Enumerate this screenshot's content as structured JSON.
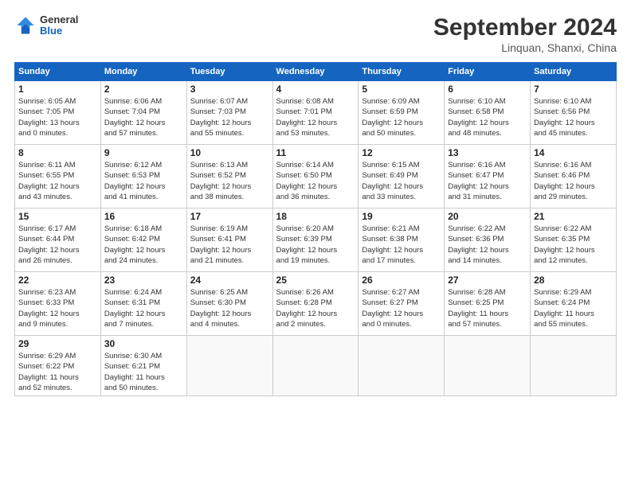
{
  "header": {
    "logo_general": "General",
    "logo_blue": "Blue",
    "month_title": "September 2024",
    "location": "Linquan, Shanxi, China"
  },
  "weekdays": [
    "Sunday",
    "Monday",
    "Tuesday",
    "Wednesday",
    "Thursday",
    "Friday",
    "Saturday"
  ],
  "weeks": [
    [
      {
        "day": "1",
        "info": "Sunrise: 6:05 AM\nSunset: 7:05 PM\nDaylight: 13 hours\nand 0 minutes."
      },
      {
        "day": "2",
        "info": "Sunrise: 6:06 AM\nSunset: 7:04 PM\nDaylight: 12 hours\nand 57 minutes."
      },
      {
        "day": "3",
        "info": "Sunrise: 6:07 AM\nSunset: 7:03 PM\nDaylight: 12 hours\nand 55 minutes."
      },
      {
        "day": "4",
        "info": "Sunrise: 6:08 AM\nSunset: 7:01 PM\nDaylight: 12 hours\nand 53 minutes."
      },
      {
        "day": "5",
        "info": "Sunrise: 6:09 AM\nSunset: 6:59 PM\nDaylight: 12 hours\nand 50 minutes."
      },
      {
        "day": "6",
        "info": "Sunrise: 6:10 AM\nSunset: 6:58 PM\nDaylight: 12 hours\nand 48 minutes."
      },
      {
        "day": "7",
        "info": "Sunrise: 6:10 AM\nSunset: 6:56 PM\nDaylight: 12 hours\nand 45 minutes."
      }
    ],
    [
      {
        "day": "8",
        "info": "Sunrise: 6:11 AM\nSunset: 6:55 PM\nDaylight: 12 hours\nand 43 minutes."
      },
      {
        "day": "9",
        "info": "Sunrise: 6:12 AM\nSunset: 6:53 PM\nDaylight: 12 hours\nand 41 minutes."
      },
      {
        "day": "10",
        "info": "Sunrise: 6:13 AM\nSunset: 6:52 PM\nDaylight: 12 hours\nand 38 minutes."
      },
      {
        "day": "11",
        "info": "Sunrise: 6:14 AM\nSunset: 6:50 PM\nDaylight: 12 hours\nand 36 minutes."
      },
      {
        "day": "12",
        "info": "Sunrise: 6:15 AM\nSunset: 6:49 PM\nDaylight: 12 hours\nand 33 minutes."
      },
      {
        "day": "13",
        "info": "Sunrise: 6:16 AM\nSunset: 6:47 PM\nDaylight: 12 hours\nand 31 minutes."
      },
      {
        "day": "14",
        "info": "Sunrise: 6:16 AM\nSunset: 6:46 PM\nDaylight: 12 hours\nand 29 minutes."
      }
    ],
    [
      {
        "day": "15",
        "info": "Sunrise: 6:17 AM\nSunset: 6:44 PM\nDaylight: 12 hours\nand 26 minutes."
      },
      {
        "day": "16",
        "info": "Sunrise: 6:18 AM\nSunset: 6:42 PM\nDaylight: 12 hours\nand 24 minutes."
      },
      {
        "day": "17",
        "info": "Sunrise: 6:19 AM\nSunset: 6:41 PM\nDaylight: 12 hours\nand 21 minutes."
      },
      {
        "day": "18",
        "info": "Sunrise: 6:20 AM\nSunset: 6:39 PM\nDaylight: 12 hours\nand 19 minutes."
      },
      {
        "day": "19",
        "info": "Sunrise: 6:21 AM\nSunset: 6:38 PM\nDaylight: 12 hours\nand 17 minutes."
      },
      {
        "day": "20",
        "info": "Sunrise: 6:22 AM\nSunset: 6:36 PM\nDaylight: 12 hours\nand 14 minutes."
      },
      {
        "day": "21",
        "info": "Sunrise: 6:22 AM\nSunset: 6:35 PM\nDaylight: 12 hours\nand 12 minutes."
      }
    ],
    [
      {
        "day": "22",
        "info": "Sunrise: 6:23 AM\nSunset: 6:33 PM\nDaylight: 12 hours\nand 9 minutes."
      },
      {
        "day": "23",
        "info": "Sunrise: 6:24 AM\nSunset: 6:31 PM\nDaylight: 12 hours\nand 7 minutes."
      },
      {
        "day": "24",
        "info": "Sunrise: 6:25 AM\nSunset: 6:30 PM\nDaylight: 12 hours\nand 4 minutes."
      },
      {
        "day": "25",
        "info": "Sunrise: 6:26 AM\nSunset: 6:28 PM\nDaylight: 12 hours\nand 2 minutes."
      },
      {
        "day": "26",
        "info": "Sunrise: 6:27 AM\nSunset: 6:27 PM\nDaylight: 12 hours\nand 0 minutes."
      },
      {
        "day": "27",
        "info": "Sunrise: 6:28 AM\nSunset: 6:25 PM\nDaylight: 11 hours\nand 57 minutes."
      },
      {
        "day": "28",
        "info": "Sunrise: 6:29 AM\nSunset: 6:24 PM\nDaylight: 11 hours\nand 55 minutes."
      }
    ],
    [
      {
        "day": "29",
        "info": "Sunrise: 6:29 AM\nSunset: 6:22 PM\nDaylight: 11 hours\nand 52 minutes."
      },
      {
        "day": "30",
        "info": "Sunrise: 6:30 AM\nSunset: 6:21 PM\nDaylight: 11 hours\nand 50 minutes."
      },
      {
        "day": "",
        "info": ""
      },
      {
        "day": "",
        "info": ""
      },
      {
        "day": "",
        "info": ""
      },
      {
        "day": "",
        "info": ""
      },
      {
        "day": "",
        "info": ""
      }
    ]
  ]
}
